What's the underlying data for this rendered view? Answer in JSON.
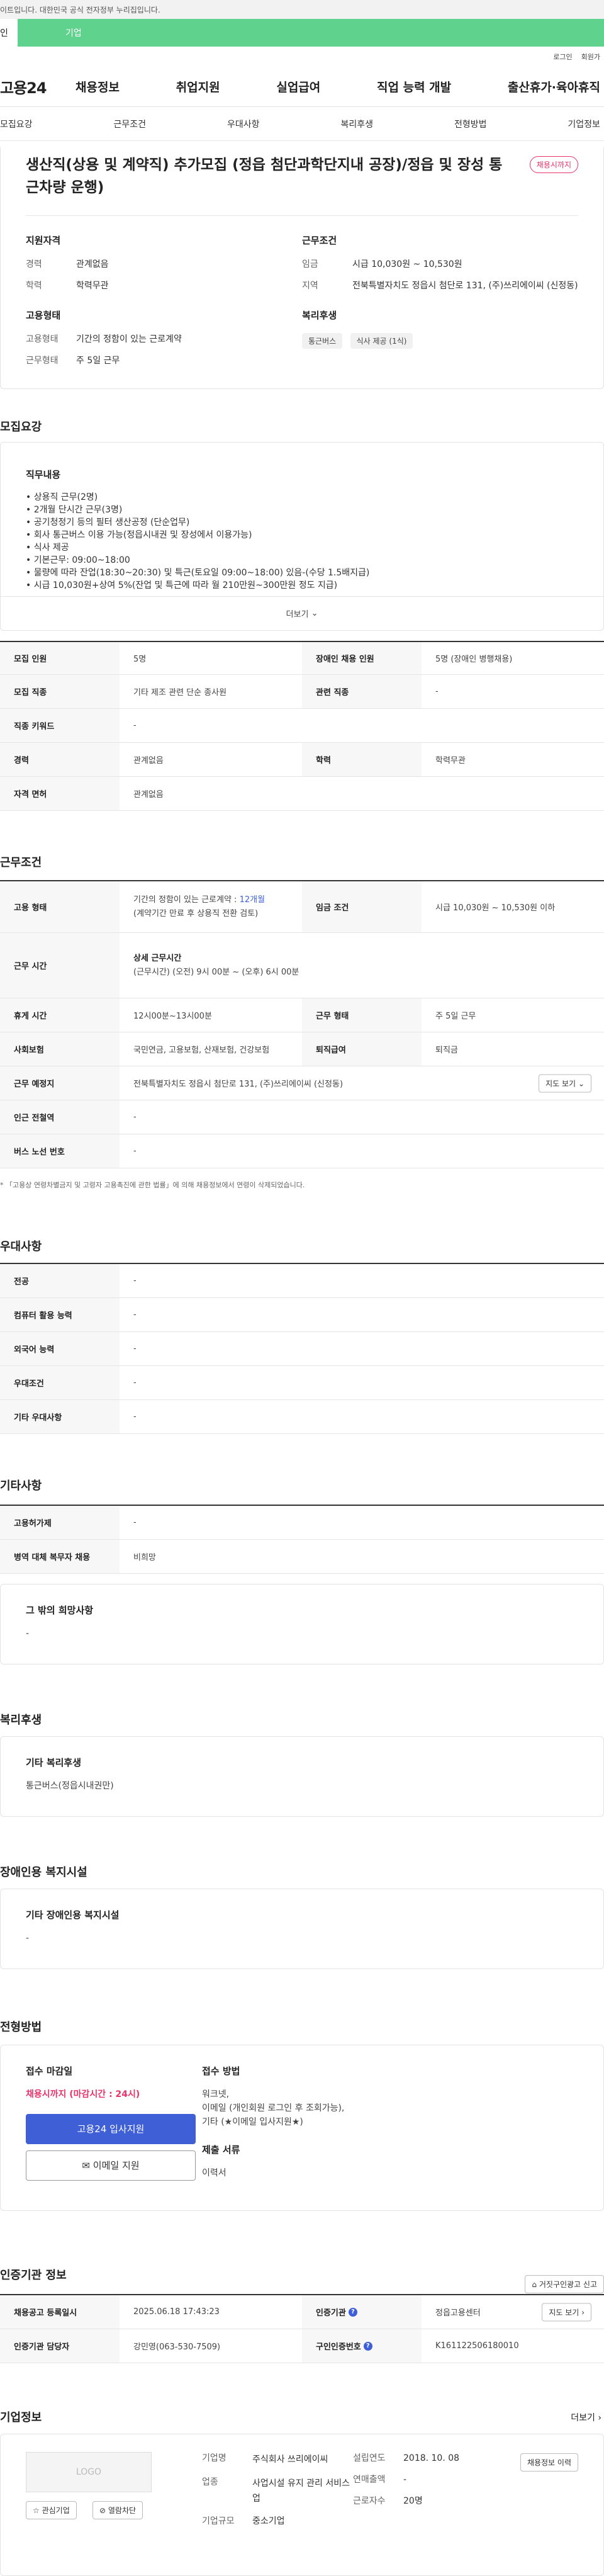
{
  "gov_banner": "이트입니다. 대한민국 공식 전자정부 누리집입니다.",
  "tabs": {
    "individual": "인",
    "enterprise": "기업"
  },
  "util": {
    "login": "로그인",
    "join": "회원가"
  },
  "logo": "고용24",
  "gnb": [
    "채용정보",
    "취업지원",
    "실업급여",
    "직업 능력 개발",
    "출산휴가·육아휴직"
  ],
  "subnav": [
    "모집요강",
    "근무조건",
    "우대사항",
    "복리후생",
    "전형방법",
    "기업정보"
  ],
  "job": {
    "title": "생산직(상용 및 계약직) 추가모집 (정읍 첨단과학단지내 공장)/정읍 및 장성 통근차량 운행)",
    "badge": "채용시까지",
    "qual_heading": "지원자격",
    "qual": [
      {
        "k": "경력",
        "v": "관계없음"
      },
      {
        "k": "학력",
        "v": "학력무관"
      }
    ],
    "cond_heading": "근무조건",
    "cond": [
      {
        "k": "임금",
        "v": "시급 10,030원 ~ 10,530원"
      },
      {
        "k": "지역",
        "v": "전북특별자치도 정읍시 첨단로 131, (주)쓰리에이씨 (신정동)"
      }
    ],
    "type_heading": "고용형태",
    "type": [
      {
        "k": "고용형태",
        "v": "기간의 정함이 있는 근로계약"
      },
      {
        "k": "근무형태",
        "v": "주 5일 근무"
      }
    ],
    "welfare_heading": "복리후생",
    "welfare_chips": [
      "통근버스",
      "식사 제공 (1식)"
    ]
  },
  "recruit": {
    "section": "모집요강",
    "duty_heading": "직무내용",
    "duty_lines": [
      "• 상용직 근무(2명)",
      "• 2개월 단시간  근무(3명)",
      "• 공기청정기 등의 필터 생산공정 (단순업무)",
      "• 회사 통근버스 이용 가능(정읍시내권 및 장성에서 이용가능)",
      "• 식사 제공",
      "• 기본근무: 09:00~18:00",
      "• 물량에 따라 잔업(18:30~20:30) 및 특근(토요일 09:00~18:00) 있음-(수당 1.5배지급)",
      "• 시급 10,030원+상여 5%(잔업 및 특근에 따라 월 210만원~300만원 정도 지급)"
    ],
    "more": "더보기",
    "rows": [
      {
        "k1": "모집 인원",
        "v1": "5명",
        "k2": "장애인 채용 인원",
        "v2": "5명 (장애인 병행채용)"
      },
      {
        "k1": "모집 직종",
        "v1": "기타 제조 관련 단순 종사원",
        "k2": "관련 직종",
        "v2": "-"
      },
      {
        "k1": "직종 키워드",
        "v1": "-"
      },
      {
        "k1": "경력",
        "v1": "관계없음",
        "k2": "학력",
        "v2": "학력무관"
      },
      {
        "k1": "자격 면허",
        "v1": "관계없음"
      }
    ]
  },
  "work": {
    "section": "근무조건",
    "emp_type_k": "고용 형태",
    "emp_type_v1": "기간의 정함이 있는 근로계약 : ",
    "emp_type_months": "12개월",
    "emp_type_v2": "(계약기간 만료 후 상용직 전환 검토)",
    "wage_k": "임금 조건",
    "wage_v": "시급 10,030원 ~ 10,530원 이하",
    "hours_k": "근무 시간",
    "hours_v1": "상세 근무시간",
    "hours_v2": "(근무시간) (오전) 9시 00분 ~ (오후) 6시 00분",
    "break_k": "휴게 시간",
    "break_v": "12시00분~13시00분",
    "form_k": "근무 형태",
    "form_v": "주 5일 근무",
    "ins_k": "사회보험",
    "ins_v": "국민연금, 고용보험, 산재보험, 건강보험",
    "ret_k": "퇴직급여",
    "ret_v": "퇴직금",
    "loc_k": "근무 예정지",
    "loc_v": "전북특별자치도 정읍시 첨단로 131, (주)쓰리에이씨 (신정동)",
    "map_btn": "지도 보기",
    "sub_k": "인근 전철역",
    "sub_v": "-",
    "bus_k": "버스 노선 번호",
    "bus_v": "-",
    "note": "「고용상 연령차별금지 및 고령자 고용촉진에 관한 법률」에 의해 채용정보에서 연령이 삭제되었습니다."
  },
  "pref": {
    "section": "우대사항",
    "rows": [
      {
        "k": "전공",
        "v": "-"
      },
      {
        "k": "컴퓨터 활용 능력",
        "v": "-"
      },
      {
        "k": "외국어 능력",
        "v": "-"
      },
      {
        "k": "우대조건",
        "v": "-"
      },
      {
        "k": "기타 우대사항",
        "v": "-"
      }
    ]
  },
  "etc": {
    "section": "기타사항",
    "rows": [
      {
        "k": "고용허가제",
        "v": "-"
      },
      {
        "k": "병역 대체 복무자 채용",
        "v": "비희망"
      }
    ],
    "other_heading": "그 밖의 희망사항",
    "other_v": "-"
  },
  "welfare": {
    "section": "복리후생",
    "heading": "기타 복리후생",
    "value": "통근버스(정읍시내권만)"
  },
  "disabled": {
    "section": "장애인용 복지시설",
    "heading": "기타 장애인용 복지시설",
    "value": "-"
  },
  "apply": {
    "section": "전형방법",
    "deadline_heading": "접수 마감일",
    "deadline_value": "채용시까지 (마감시간 : 24시)",
    "apply_btn": "고용24 입사지원",
    "email_btn": "이메일 지원",
    "method_heading": "접수 방법",
    "method_lines": [
      "워크넷,",
      "이메일 (개인회원 로그인 후 조회가능),",
      "기타 (★이메일 입사지원★)"
    ],
    "docs_heading": "제출 서류",
    "docs_value": "이력서"
  },
  "cert": {
    "section": "인증기관 정보",
    "report_btn": "거짓구인광고 신고",
    "rows": [
      {
        "k1": "채용공고 등록일시",
        "v1": "2025.06.18 17:43:23",
        "k2": "인증기관",
        "v2": "정읍고용센터",
        "btn": "지도 보기"
      },
      {
        "k1": "인증기관 담당자",
        "v1": "강민영(063-530-7509)",
        "k2": "구인인증번호",
        "v2": "K161122506180010"
      }
    ]
  },
  "company": {
    "section": "기업정보",
    "more": "더보기",
    "logo_text": "LOGO",
    "interest_btn": "관심기업",
    "block_btn": "열람차단",
    "rows": [
      {
        "k": "기업명",
        "v": "주식회사 쓰리에이씨"
      },
      {
        "k": "업종",
        "v": "사업시설 유지 관리 서비스업"
      },
      {
        "k": "기업규모",
        "v": "중소기업"
      }
    ],
    "rows2": [
      {
        "k": "설립연도",
        "v": "2018. 10. 08"
      },
      {
        "k": "연매출액",
        "v": "-"
      },
      {
        "k": "근로자수",
        "v": "20명"
      }
    ],
    "jobs_btn": "채용정보 이력"
  }
}
